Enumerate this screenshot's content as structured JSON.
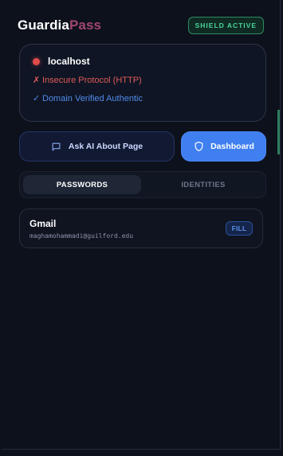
{
  "header": {
    "brand_part1": "Guardia",
    "brand_part2": "Pass",
    "badge": "SHIELD ACTIVE"
  },
  "site": {
    "host": "localhost",
    "warning_glyph": "✗",
    "warning_text": "Insecure Protocol (HTTP)",
    "verified_glyph": "✓",
    "verified_text": "Domain Verified Authentic"
  },
  "actions": {
    "ask_ai_label": "Ask AI About Page",
    "dashboard_label": "Dashboard"
  },
  "tabs": [
    {
      "label": "PASSWORDS",
      "active": true
    },
    {
      "label": "IDENTITIES",
      "active": false
    }
  ],
  "entries": [
    {
      "title": "Gmail",
      "username": "maghamohammadi@guilford.edu",
      "action_label": "FILL"
    }
  ],
  "colors": {
    "background": "#0d111c",
    "brand_accent": "#a0466c",
    "danger": "#e05a59",
    "info": "#4f8bea",
    "primary": "#3f7ff0",
    "success": "#49d69b"
  }
}
